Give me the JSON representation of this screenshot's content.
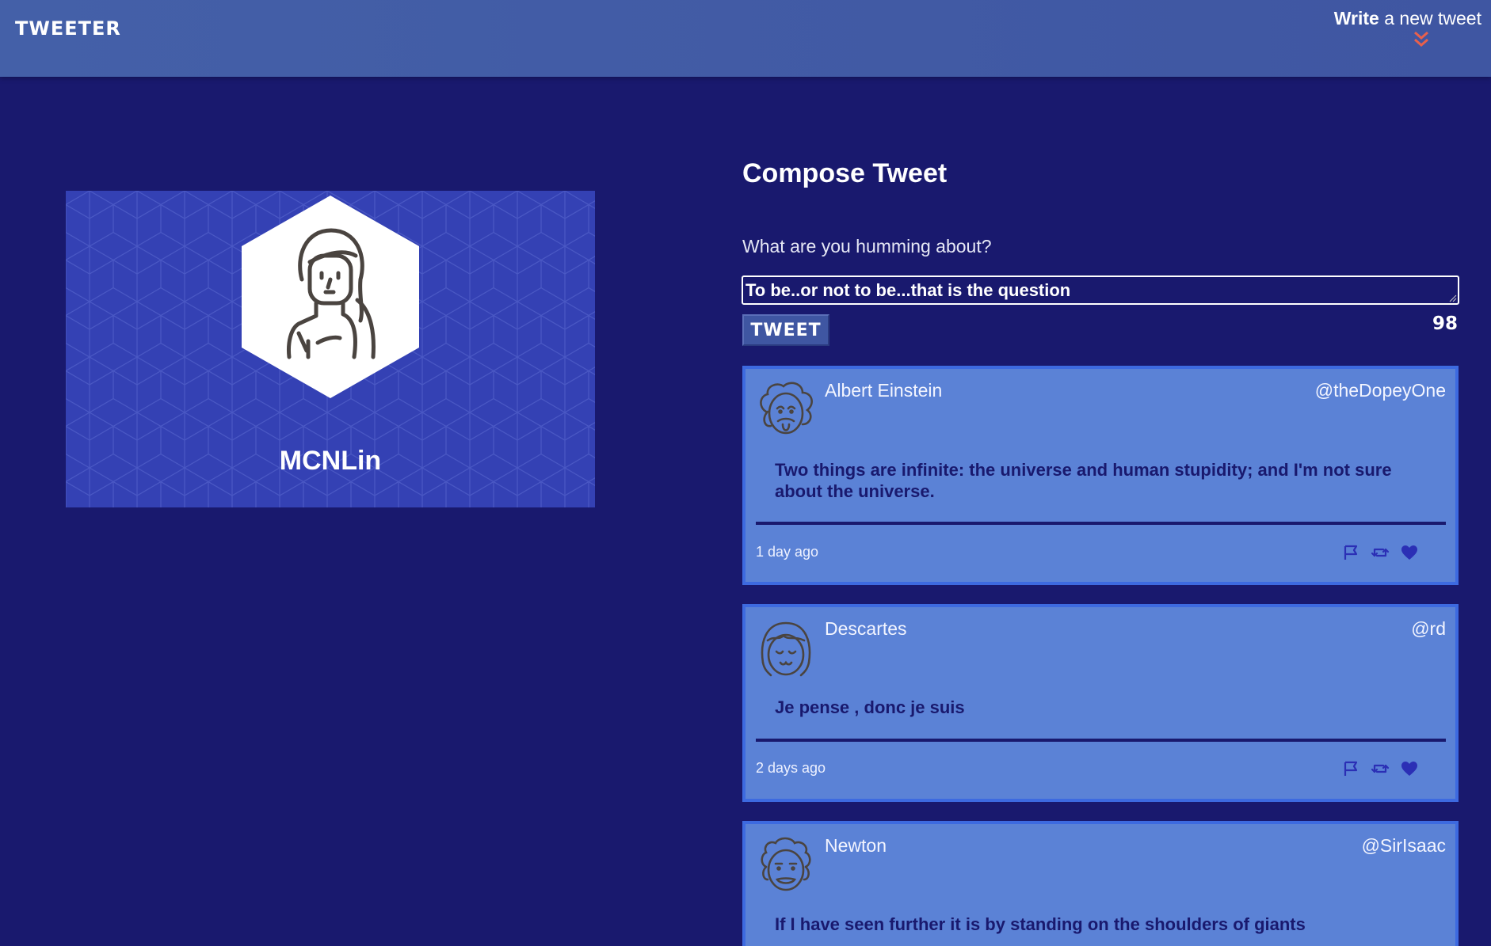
{
  "header": {
    "brand": "TWEETER",
    "write_bold": "Write",
    "write_rest": " a new tweet",
    "toggle_icon": "double-chevron-down-icon",
    "colors": {
      "bar": "#4460a8",
      "accent": "#e8604c"
    }
  },
  "profile": {
    "name": "MCNLin",
    "avatar_icon": "woman-avatar-icon",
    "colors": {
      "card": "#3441b4",
      "hexagon": "#ffffff"
    }
  },
  "compose": {
    "title": "Compose Tweet",
    "label": "What are you humming about?",
    "input_value": "To be..or not to be...that is the question",
    "button_label": "TWEET",
    "char_count": "98"
  },
  "tweets": [
    {
      "name": "Albert Einstein",
      "handle": "@theDopeyOne",
      "avatar_icon": "einstein-avatar-icon",
      "body": "Two things are infinite: the universe and human stupidity; and I'm not sure about the universe.",
      "time": "1 day ago"
    },
    {
      "name": "Descartes",
      "handle": "@rd",
      "avatar_icon": "descartes-avatar-icon",
      "body": "Je pense , donc je suis",
      "time": "2 days ago"
    },
    {
      "name": "Newton",
      "handle": "@SirIsaac",
      "avatar_icon": "newton-avatar-icon",
      "body": "If I have seen further it is by standing on the shoulders of giants",
      "time": ""
    }
  ],
  "tweet_actions": [
    "flag-icon",
    "retweet-icon",
    "heart-icon"
  ],
  "colors": {
    "page_bg": "#19196e",
    "tweet_bg": "#5b82d6",
    "tweet_border": "#3d6ae0",
    "icon": "#2b2fb5"
  }
}
